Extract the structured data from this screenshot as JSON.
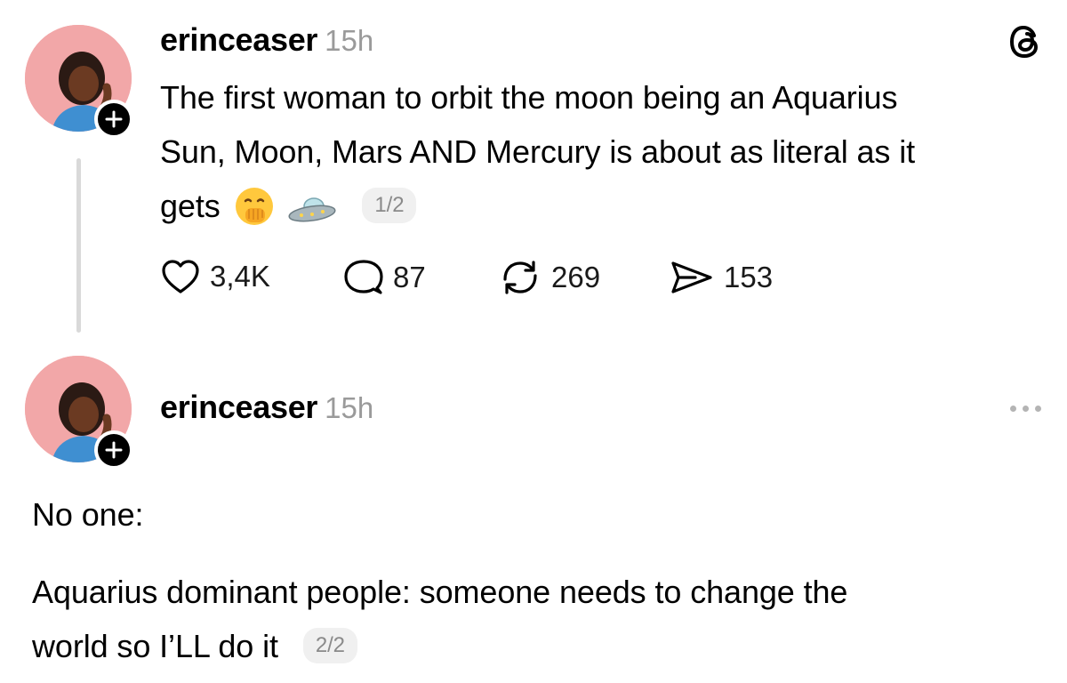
{
  "posts": [
    {
      "username": "erinceaser",
      "timestamp": "15h",
      "text_lines": [
        "The first woman to orbit the moon being an Aquarius",
        "Sun, Moon, Mars AND Mercury is about as literal as it",
        "gets"
      ],
      "emojis": [
        "hand-over-mouth-emoji",
        "flying-saucer-emoji"
      ],
      "pager": "1/2",
      "actions": {
        "likes": "3,4K",
        "replies": "87",
        "reposts": "269",
        "shares": "153"
      },
      "corner_icon": "threads-logo-icon"
    },
    {
      "username": "erinceaser",
      "timestamp": "15h",
      "line1": "No one:",
      "line2": "Aquarius dominant people: someone needs to change the",
      "line3": "world so I’LL do it",
      "pager": "2/2",
      "corner_icon": "more-options-icon"
    }
  ],
  "colors": {
    "avatar_bg": "#f2a7a8",
    "timestamp": "#9a9a9a",
    "thread_line": "#d9d9d9",
    "pager_bg": "#f0f0f0"
  }
}
